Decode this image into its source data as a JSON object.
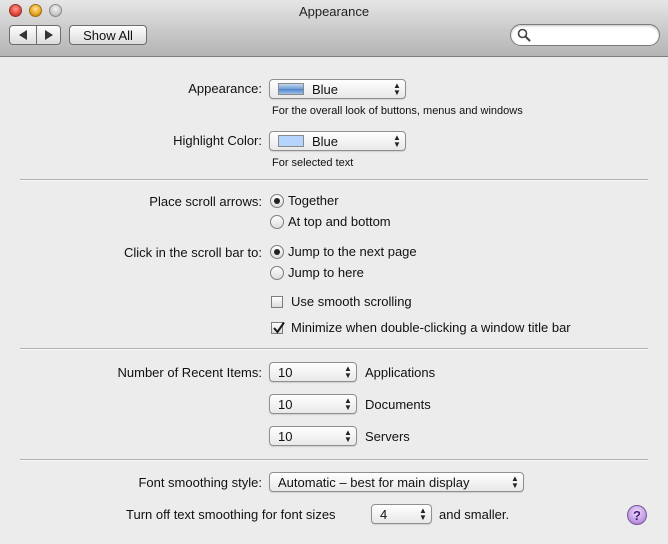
{
  "window": {
    "title": "Appearance",
    "show_all_label": "Show All",
    "search": {
      "value": "",
      "placeholder": ""
    }
  },
  "appearance": {
    "label": "Appearance:",
    "value": "Blue",
    "hint": "For the overall look of buttons, menus and windows"
  },
  "highlight": {
    "label": "Highlight Color:",
    "value": "Blue",
    "hint": "For selected text"
  },
  "scroll_arrows": {
    "label": "Place scroll arrows:",
    "options": [
      {
        "label": "Together",
        "selected": true
      },
      {
        "label": "At top and bottom",
        "selected": false
      }
    ]
  },
  "scroll_bar_click": {
    "label": "Click in the scroll bar to:",
    "options": [
      {
        "label": "Jump to the next page",
        "selected": true
      },
      {
        "label": "Jump to here",
        "selected": false
      }
    ]
  },
  "checkboxes": {
    "smooth_scrolling": {
      "label": "Use smooth scrolling",
      "checked": false
    },
    "minimize_double_click": {
      "label": "Minimize when double-clicking a window title bar",
      "checked": true
    }
  },
  "recent_items": {
    "label": "Number of Recent Items:",
    "applications": {
      "value": "10",
      "label": "Applications"
    },
    "documents": {
      "value": "10",
      "label": "Documents"
    },
    "servers": {
      "value": "10",
      "label": "Servers"
    }
  },
  "font_smoothing": {
    "label": "Font smoothing style:",
    "value": "Automatic – best for main display"
  },
  "text_smoothing": {
    "label": "Turn off text smoothing for font sizes",
    "value": "4",
    "suffix": "and smaller."
  },
  "help_label": "?",
  "colors": {
    "appearance_blue": "#5b8fce",
    "highlight_blue": "#b5d5ff",
    "window_bg": "#ececec"
  }
}
